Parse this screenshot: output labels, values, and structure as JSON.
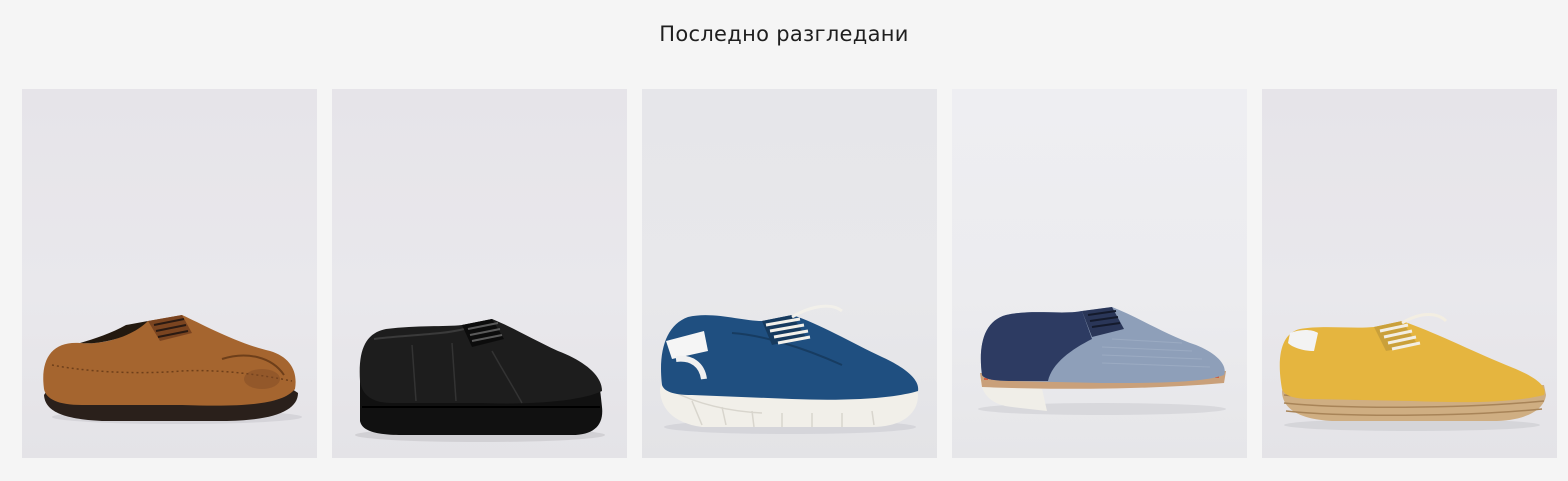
{
  "section": {
    "title": "Последно разгледани"
  },
  "products": [
    {
      "name": "brown-suede-brogue",
      "color": "#a0622f"
    },
    {
      "name": "black-leather-sneaker",
      "color": "#1a1a1a"
    },
    {
      "name": "blue-leather-sneaker",
      "color": "#1f4f7e"
    },
    {
      "name": "navy-denim-derby",
      "color": "#2e3d64"
    },
    {
      "name": "yellow-espadrille-sneaker",
      "color": "#e4b33e"
    }
  ]
}
